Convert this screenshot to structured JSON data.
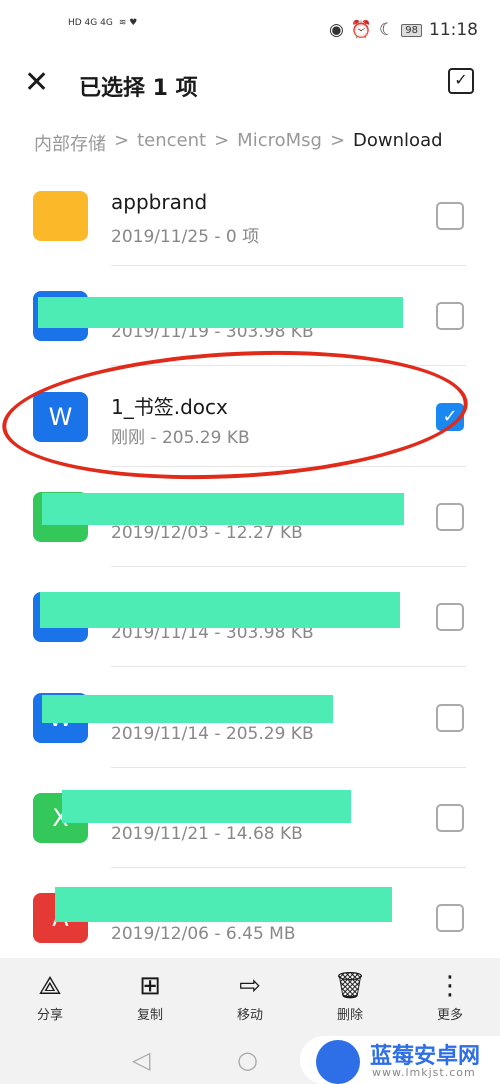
{
  "status": {
    "left": "HD 4G 4G",
    "time": "11:18",
    "battery": "98"
  },
  "header": {
    "title": "已选择 1 项"
  },
  "breadcrumb": [
    "内部存储",
    "tencent",
    "MicroMsg",
    "Download"
  ],
  "files": [
    {
      "name": "appbrand",
      "meta": "2019/11/25 - 0 项",
      "type": "folder",
      "color": "#fbb829",
      "checked": false,
      "glyph": ""
    },
    {
      "name": "",
      "meta": "2019/11/19 - 303.98 KB",
      "type": "word",
      "color": "#1a73e8",
      "checked": false,
      "glyph": "W"
    },
    {
      "name": "1_书签.docx",
      "meta": "刚刚 - 205.29 KB",
      "type": "word",
      "color": "#1a73e8",
      "checked": true,
      "glyph": "W"
    },
    {
      "name": "",
      "meta": "2019/12/03 - 12.27 KB",
      "type": "excel",
      "color": "#34c759",
      "checked": false,
      "glyph": "X"
    },
    {
      "name": "",
      "meta": "2019/11/14 - 303.98 KB",
      "type": "word",
      "color": "#1a73e8",
      "checked": false,
      "glyph": "W"
    },
    {
      "name": "",
      "meta": "2019/11/14 - 205.29 KB",
      "type": "word",
      "color": "#1a73e8",
      "checked": false,
      "glyph": "W"
    },
    {
      "name": "",
      "meta": "2019/11/21 - 14.68 KB",
      "type": "excel",
      "color": "#34c759",
      "checked": false,
      "glyph": "X"
    },
    {
      "name": "",
      "meta": "2019/12/06 - 6.45 MB",
      "type": "pdf",
      "color": "#e53935",
      "checked": false,
      "glyph": "A"
    }
  ],
  "actions": [
    {
      "label": "分享",
      "icon": "share-icon",
      "glyph": "⟁"
    },
    {
      "label": "复制",
      "icon": "copy-icon",
      "glyph": "⊞"
    },
    {
      "label": "移动",
      "icon": "move-icon",
      "glyph": "⇨"
    },
    {
      "label": "删除",
      "icon": "delete-icon",
      "glyph": "🗑"
    },
    {
      "label": "更多",
      "icon": "more-icon",
      "glyph": "⋮"
    }
  ],
  "watermark": {
    "title": "蓝莓安卓网",
    "url": "www.lmkjst.com"
  }
}
